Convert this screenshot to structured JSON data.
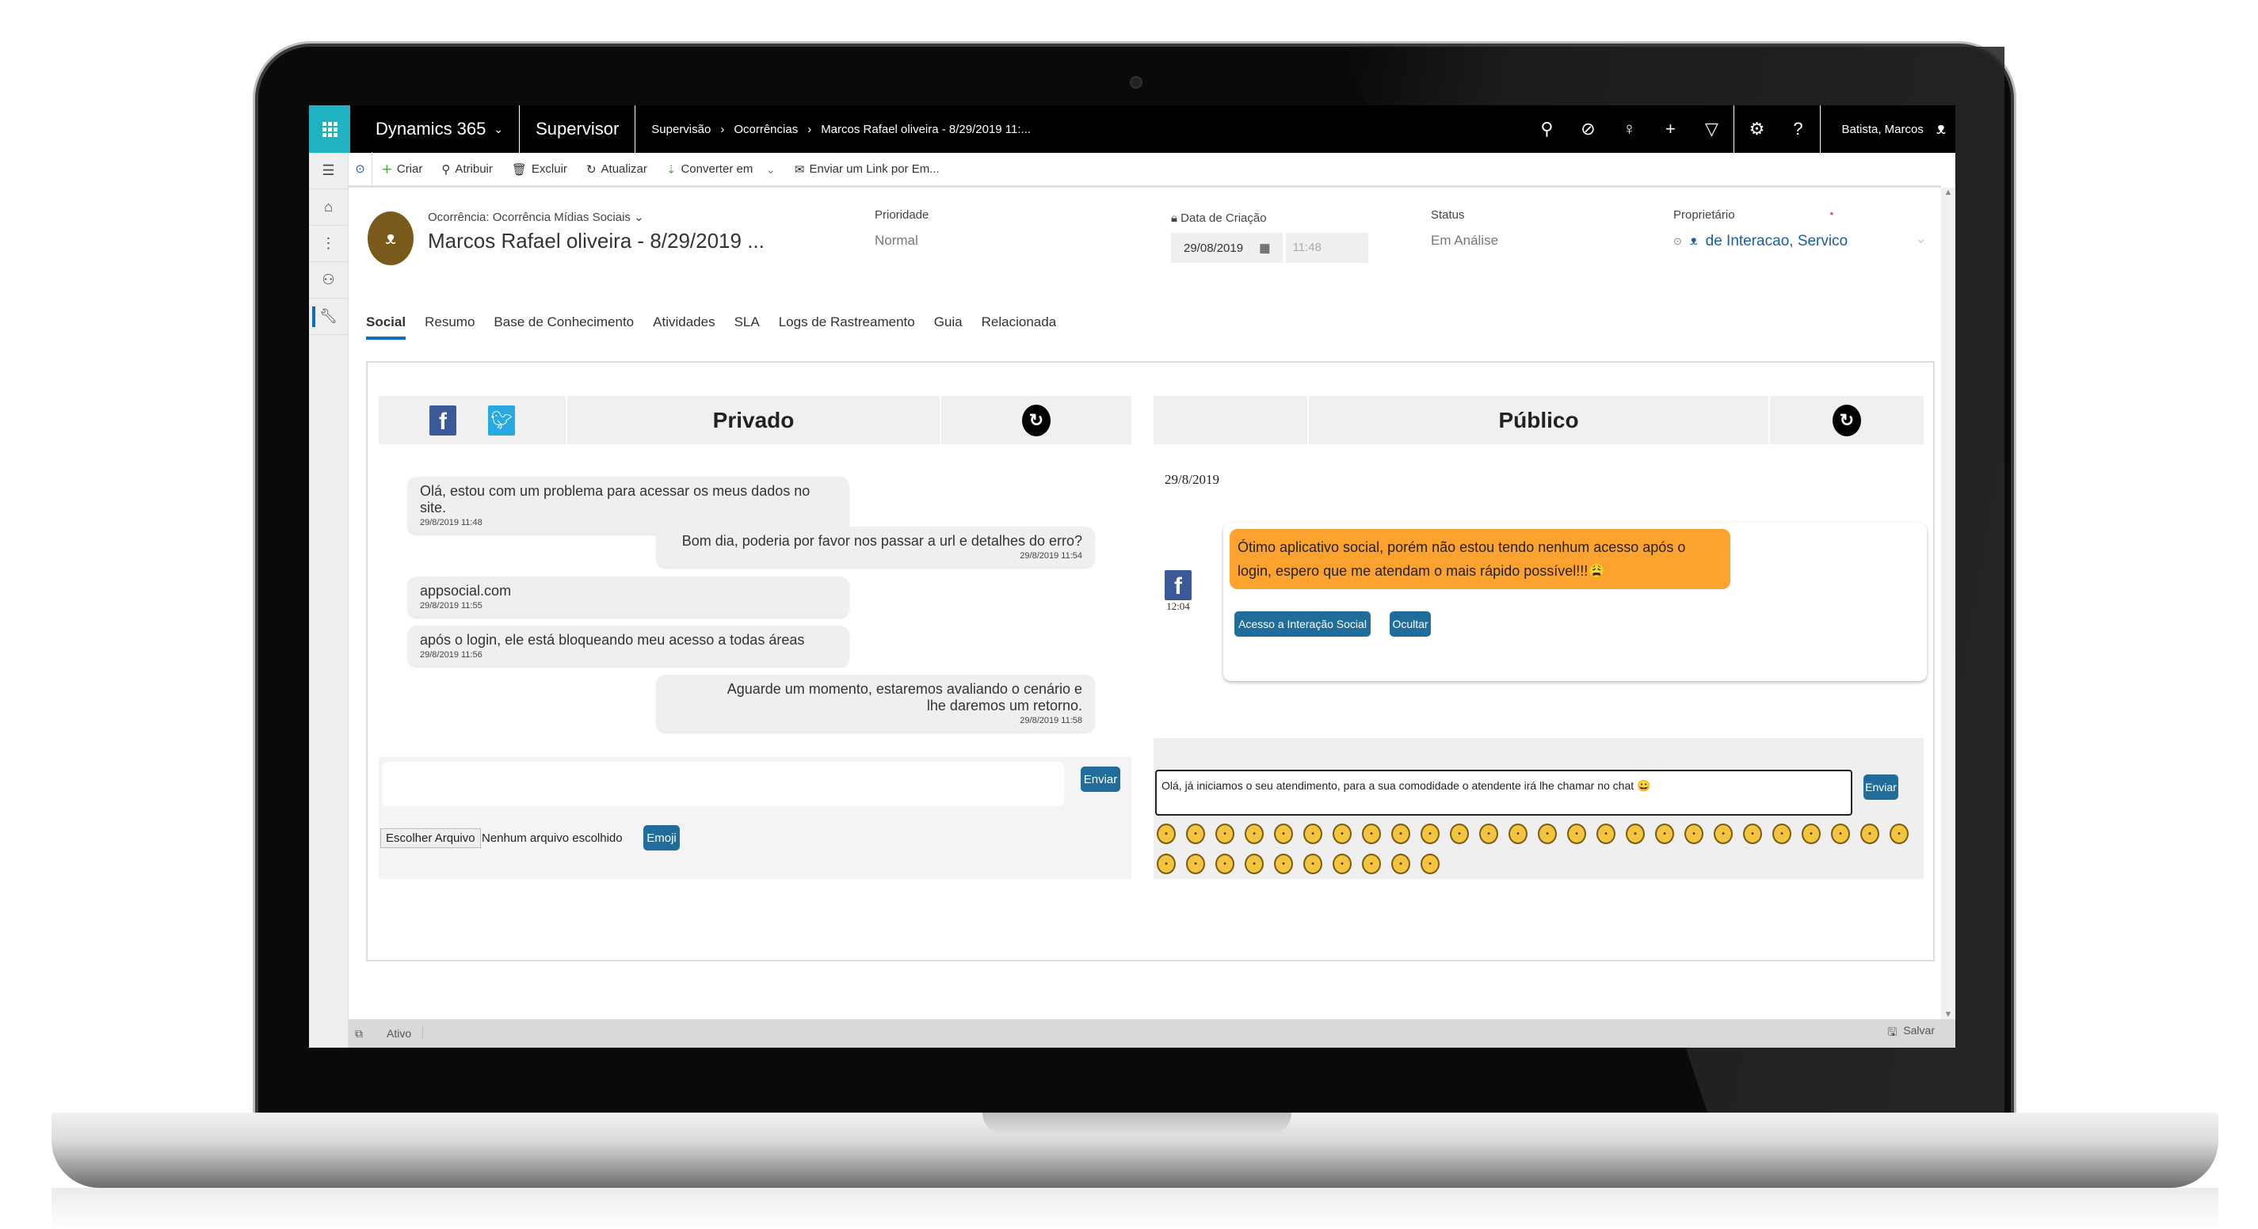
{
  "topnav": {
    "app_name": "Dynamics 365",
    "module": "Supervisor",
    "breadcrumb": [
      "Supervisão",
      "Ocorrências",
      "Marcos Rafael oliveira - 8/29/2019 11:..."
    ],
    "icons": [
      "search-icon",
      "task-icon",
      "lightbulb-icon",
      "plus-icon",
      "filter-icon",
      "gear-icon",
      "help-icon"
    ],
    "user_name": "Batista, Marcos"
  },
  "commandbar": {
    "items": [
      {
        "label": "Criar",
        "icon": "plus-icon"
      },
      {
        "label": "Atribuir",
        "icon": "assign-icon"
      },
      {
        "label": "Excluir",
        "icon": "trash-icon"
      },
      {
        "label": "Atualizar",
        "icon": "refresh-icon"
      },
      {
        "label": "Converter em",
        "icon": "convert-icon"
      },
      {
        "label": "Enviar um Link por Em...",
        "icon": "email-link-icon"
      }
    ]
  },
  "record": {
    "type_label": "Ocorrência: Ocorrência Mídias Sociais",
    "title": "Marcos Rafael oliveira - 8/29/2019 ...",
    "fields": {
      "priority_label": "Prioridade",
      "priority_value": "Normal",
      "created_label": "Data de Criação",
      "created_date": "29/08/2019",
      "created_time": "11:48",
      "status_label": "Status",
      "status_value": "Em Análise",
      "owner_label": "Proprietário",
      "owner_required_mark": "*",
      "owner_value": "de Interacao, Servico"
    }
  },
  "tabs": [
    "Social",
    "Resumo",
    "Base de Conhecimento",
    "Atividades",
    "SLA",
    "Logs de Rastreamento",
    "Guia",
    "Relacionada"
  ],
  "private": {
    "title": "Privado",
    "messages": [
      {
        "text": "Olá, estou com um problema para acessar os meus dados no site.",
        "time": "29/8/2019 11:48",
        "side": "left"
      },
      {
        "text": "Bom dia, poderia por favor nos passar a url e detalhes do erro?",
        "time": "29/8/2019 11:54",
        "side": "right"
      },
      {
        "text": "appsocial.com",
        "time": "29/8/2019 11:55",
        "side": "left"
      },
      {
        "text": "após o login, ele está bloqueando meu acesso a todas áreas",
        "time": "29/8/2019 11:56",
        "side": "left"
      },
      {
        "text": "Aguarde um momento, estaremos avaliando o cenário e lhe daremos um retorno.",
        "time": "29/8/2019 11:58",
        "side": "right"
      }
    ],
    "input_value": "",
    "send_label": "Enviar",
    "file_button": "Escolher Arquivo",
    "file_status": "Nenhum arquivo escolhido",
    "emoji_label": "Emoji"
  },
  "public": {
    "title": "Público",
    "date": "29/8/2019",
    "post_time": "12:04",
    "post_text": "Ótimo aplicativo social, porém não estou tendo nenhum acesso após o login, espero que me atendam o mais rápido possível!!!😩",
    "access_button": "Acesso a Interação Social",
    "hide_button": "Ocultar",
    "reply_value": "Olá, já iniciamos o seu atendimento, para a sua comodidade o atendente irá lhe chamar no chat 😀",
    "send_label": "Enviar",
    "emoji_count": 36
  },
  "footer": {
    "status": "Ativo",
    "save_label": "Salvar"
  }
}
